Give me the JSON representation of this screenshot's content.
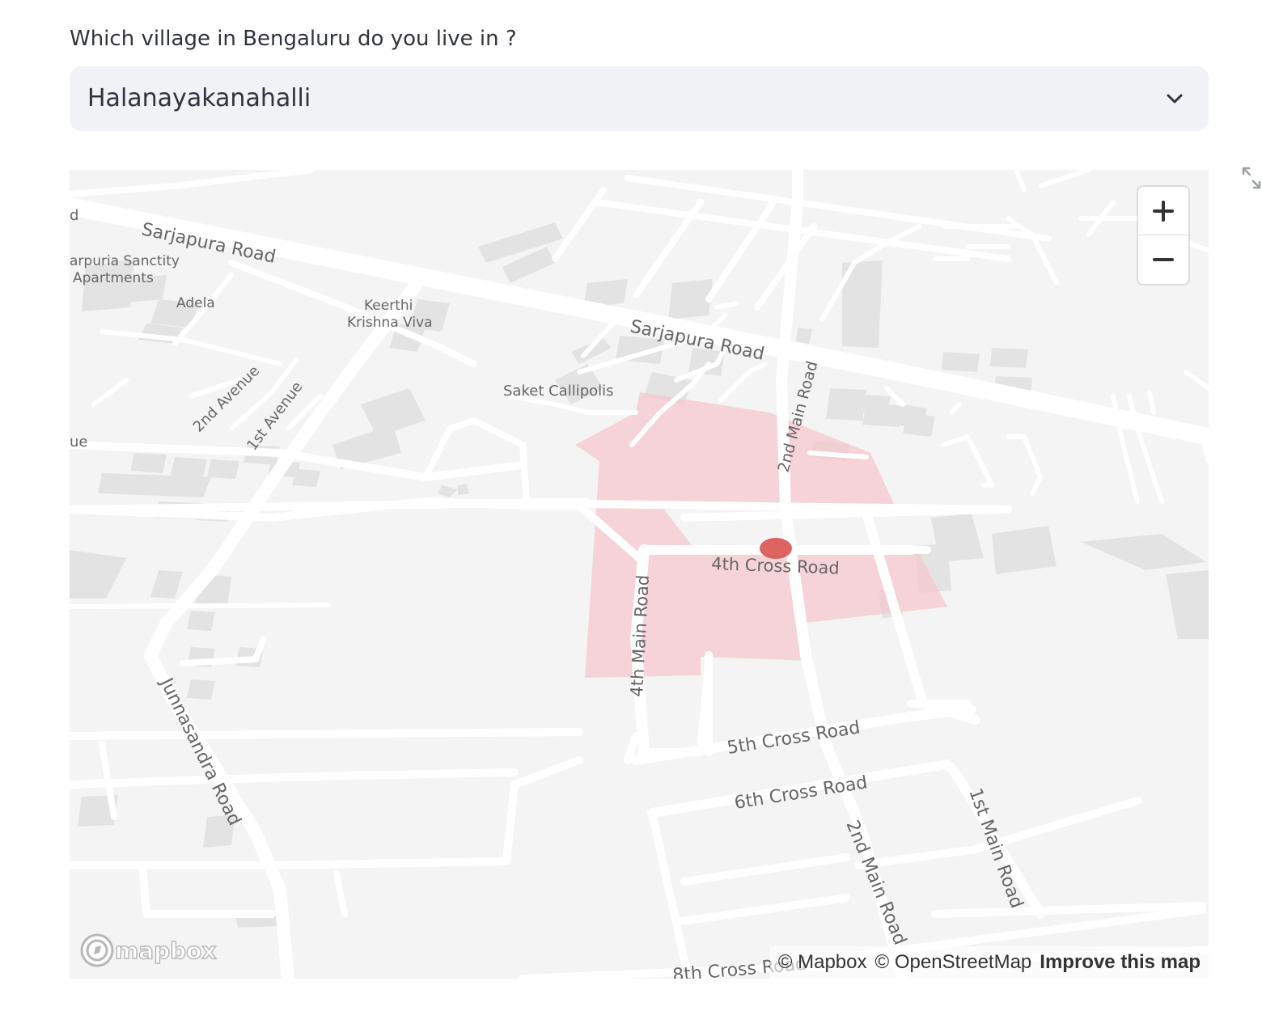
{
  "select": {
    "label": "Which village in Bengaluru do you live in ?",
    "value": "Halanayakanahalli"
  },
  "map": {
    "labels": {
      "sarjapura_road_1": "Sarjapura Road",
      "sarjapura_road_2": "Sarjapura Road",
      "sanctity_1": "arpuria Sanctity",
      "sanctity_2": "Apartments",
      "adela": "Adela",
      "keerthi_1": "Keerthi",
      "keerthi_2": "Krishna Viva",
      "saket": "Saket Callipolis",
      "second_avenue": "2nd Avenue",
      "first_avenue": "1st Avenue",
      "ue": "ue",
      "d": "d",
      "second_main_top": "2nd Main Road",
      "fourth_cross": "4th Cross Road",
      "fourth_main": "4th Main Road",
      "fifth_cross": "5th Cross Road",
      "sixth_cross": "6th Cross Road",
      "junnasandra": "Junnasandra Road",
      "second_main_bottom": "2nd Main Road",
      "first_main": "1st Main Road",
      "eighth_cross": "8th Cross Road"
    },
    "region_color": "#f6c5cc",
    "marker_color": "#d9534f"
  },
  "attribution": {
    "mapbox": "© Mapbox",
    "osm": "© OpenStreetMap",
    "improve": "Improve this map"
  },
  "logo_text": "mapbox"
}
